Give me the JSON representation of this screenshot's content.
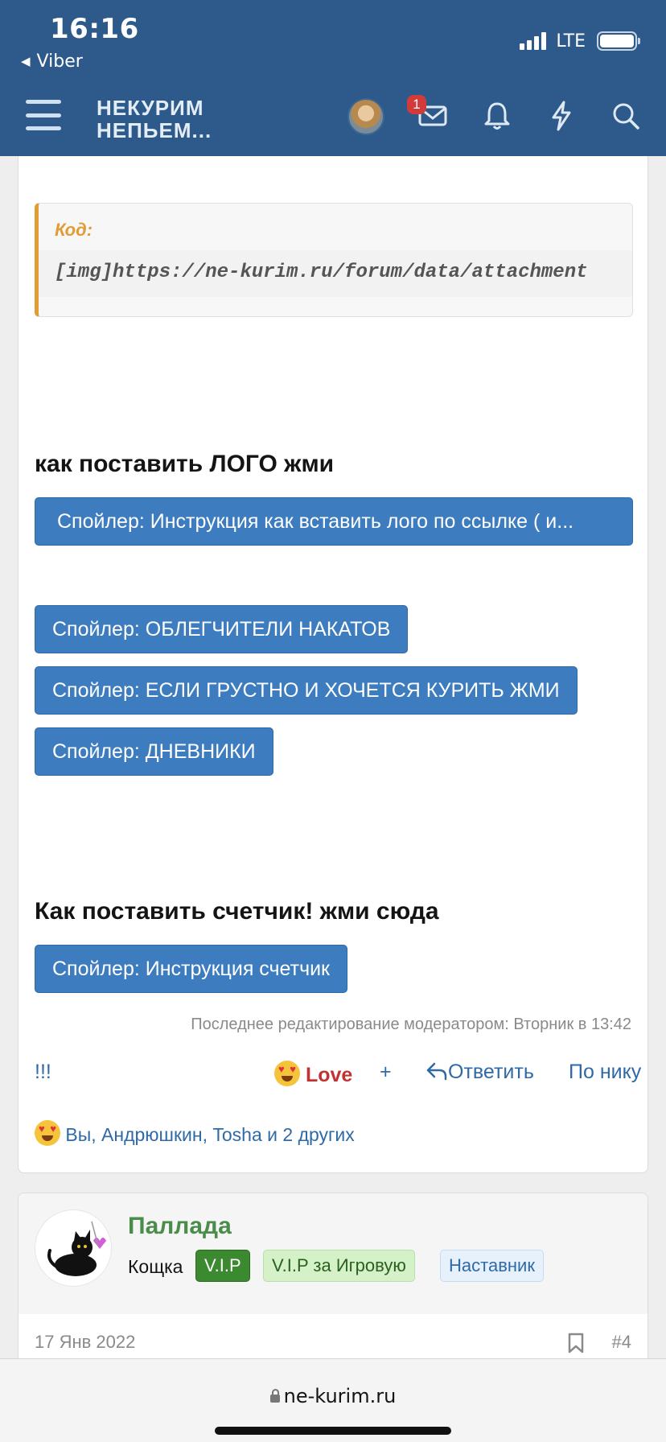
{
  "status_bar": {
    "time": "16:16",
    "back_app": "Viber",
    "network": "LTE"
  },
  "header": {
    "logo_line1": "НЕКУРИМ",
    "logo_line2": "НЕПЬЕМ...",
    "inbox_badge": "1",
    "icons": [
      "menu-icon",
      "avatar",
      "mail-icon",
      "bell-icon",
      "bolt-icon",
      "search-icon"
    ]
  },
  "post": {
    "code_block": {
      "title": "Код:",
      "content": "[img]https://ne-kurim.ru/forum/data/attachment"
    },
    "logo_heading": "как поставить ЛОГО жми",
    "spoilers_top": [
      "Спойлер: Инструкция как вставить лого по ссылке ( и..."
    ],
    "spoilers_middle": [
      "Спойлер: ОБЛЕГЧИТЕЛИ НАКАТОВ",
      "Спойлер: ЕСЛИ ГРУСТНО И ХОЧЕТСЯ КУРИТЬ ЖМИ",
      "Спойлер: ДНЕВНИКИ"
    ],
    "counter_heading": "Как поставить счетчик! жми сюда",
    "counter_spoiler": "Спойлер: Инструкция счетчик",
    "edited_note": "Последнее редактирование модератором: Вторник в 13:42",
    "actions": {
      "exclaim": "!!!",
      "love": "Love",
      "plus": "+",
      "reply": "Ответить",
      "by_nick": "По нику"
    },
    "reactions_text": "Вы, Андрюшкин, Tosha и 2 других"
  },
  "next_post": {
    "username": "Паллада",
    "user_title": "Кощка",
    "tags": [
      "V.I.P",
      "V.I.P за Игровую",
      "Наставник"
    ],
    "date": "17 Янв 2022",
    "post_number": "#4"
  },
  "browser": {
    "url": "ne-kurim.ru"
  },
  "colors": {
    "header_bg": "#2d5a8a",
    "spoiler_bg": "#3d7cbf",
    "code_accent": "#e29c34",
    "link": "#2f6aa6",
    "love": "#c33232",
    "username": "#4a8c4a"
  }
}
